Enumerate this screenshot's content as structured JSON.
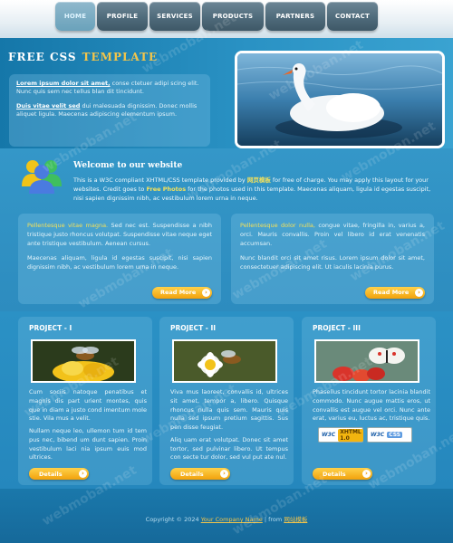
{
  "nav": {
    "items": [
      {
        "label": "HOME"
      },
      {
        "label": "PROFILE"
      },
      {
        "label": "SERVICES"
      },
      {
        "label": "PRODUCTS"
      },
      {
        "label": "PARTNERS"
      },
      {
        "label": "CONTACT"
      }
    ]
  },
  "header": {
    "title_word1": "FREE CSS",
    "title_word2": "TEMPLATE",
    "intro": [
      {
        "lead": "Lorem ipsum dolor sit amet,",
        "text": " conse ctetuer adipi scing elit. Nunc quis sem nec tellus blan dit tincidunt."
      },
      {
        "lead": "Duis vitae velit sed",
        "text": " dui malesuada dignissim. Donec mollis aliquet ligula. Maecenas adipiscing elementum ipsum."
      }
    ]
  },
  "welcome": {
    "title": "Welcome to our website",
    "text_a": "This is a W3C compliant XHTML/CSS template provided by ",
    "brand": "网页模板",
    "text_b": " for free of charge. You may apply this layout for your websites. Credit goes to ",
    "free_photos": "Free Photos",
    "text_c": " for the photos used in this template. Maecenas aliquam, ligula id egestas suscipit, nisi sapien dignissim nibh, ac vestibulum lorem urna in neque."
  },
  "columns": [
    {
      "lead": "Pellentesque vitae magna.",
      "p1": " Sed nec est. Suspendisse a nibh tristique justo rhoncus volutpat. Suspendisse vitae neque eget ante tristique vestibulum. Aenean cursus.",
      "p2": "Maecenas aliquam, ligula id egestas suscipit, nisi sapien dignissim nibh, ac vestibulum lorem urna in neque.",
      "button": "Read More"
    },
    {
      "lead": "Pellentesque dolor nulla,",
      "p1": " congue vitae, fringilla in, varius a, orci. Mauris convallis. Proin vel libero id erat venenatis accumsan.",
      "p2": "Nunc blandit orci sit amet risus. Lorem ipsum dolor sit amet, consectetuer adipiscing elit. Ut iaculis lacinia purus.",
      "button": "Read More"
    }
  ],
  "projects": [
    {
      "title": "PROJECT - I",
      "p1": "Cum sociis natoque penatibus et magnis dis part urient montes, quis que in diam a justo cond imentum mole stie. Vila mus a velit.",
      "p2": "Nullam neque leo, ullemon tum id tem pus nec, bibend um dunt sapien. Proin vestibulum laci nia ipsum euis mod ultrices.",
      "button": "Details"
    },
    {
      "title": "PROJECT - II",
      "p1": "Viva mus laoreet, convallis id, ultrices sit amet, tempor a, libero. Quisque rhoncus nulla quis sem. Mauris quis nulla sed ipsum pretium sagittis. Sus pen disse feugiat.",
      "p2": "Aliq uam erat volutpat. Donec sit amet tortor, sed pulvinar libero. Ut tempus con secte tur dolor, sed vul put ate nul.",
      "button": "Details"
    },
    {
      "title": "PROJECT - III",
      "p1": "Phasellus tincidunt tortor lacinia blandit commodo. Nunc augue mattis eros, ut convallis est augue vel orci. Nunc ante erat, varius eu, luctus ac, tristique quis.",
      "badge1": "XHTML 1.0",
      "badge2": "CSS",
      "button": "Details"
    }
  ],
  "footer": {
    "prefix": "Copyright © 2024 ",
    "company": "Your Company Name",
    "mid": " | from ",
    "source": "网站模板"
  },
  "watermark": "webmoban.net",
  "colors": {
    "accent_yellow": "#f3c54a",
    "highlight": "#f4e15a",
    "button_orange": "#f2a10c",
    "panel_blue": "#2b91c5"
  }
}
